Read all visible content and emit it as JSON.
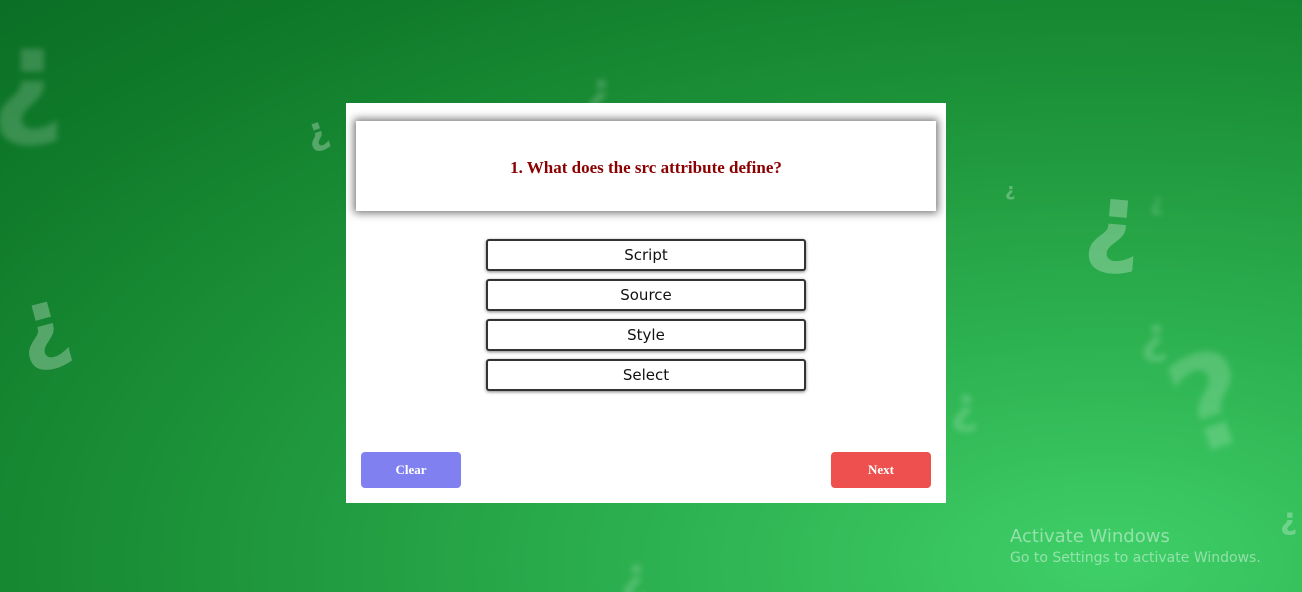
{
  "colors": {
    "question_text": "#8b0000",
    "clear_button": "#8080f0",
    "next_button": "#ee5050"
  },
  "question": {
    "text": "1. What does the src attribute define?"
  },
  "options": [
    {
      "label": "Script"
    },
    {
      "label": "Source"
    },
    {
      "label": "Style"
    },
    {
      "label": "Select"
    }
  ],
  "buttons": {
    "clear_label": "Clear",
    "next_label": "Next"
  },
  "watermark": {
    "title": "Activate Windows",
    "subtitle": "Go to Settings to activate Windows."
  }
}
